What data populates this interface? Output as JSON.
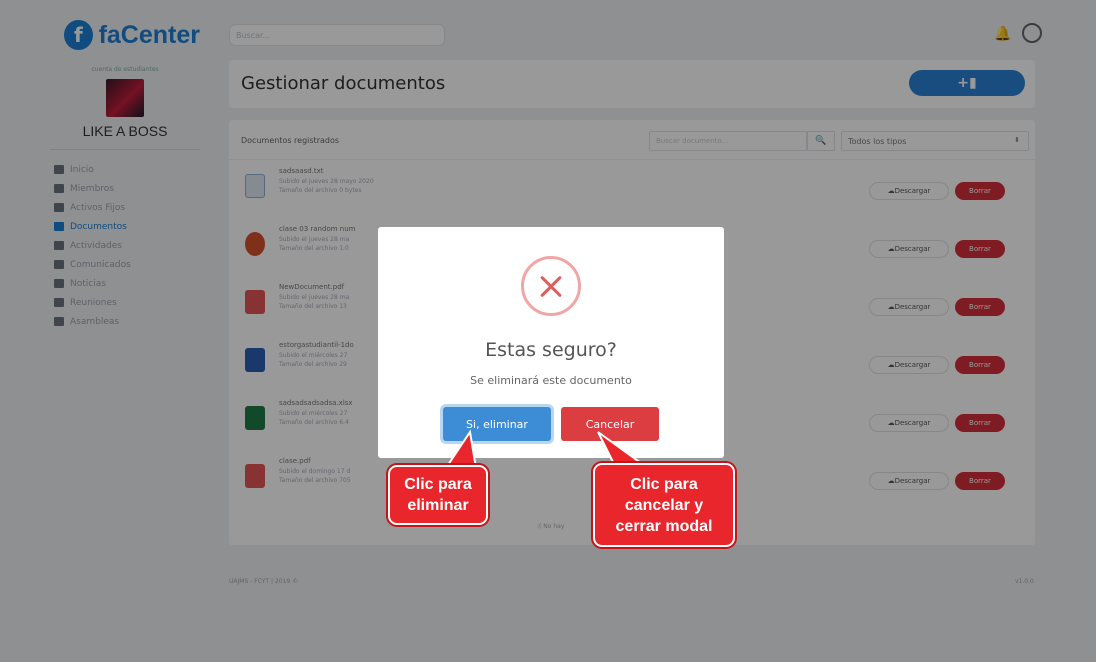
{
  "app": {
    "logo_text": "faCenter",
    "logo_letter": "f",
    "user_caption": "cuenta de estudiantes",
    "user_name": "LIKE A BOSS",
    "nav": [
      {
        "label": "Inicio",
        "active": false
      },
      {
        "label": "Miembros",
        "active": false
      },
      {
        "label": "Activos Fijos",
        "active": false
      },
      {
        "label": "Documentos",
        "active": true
      },
      {
        "label": "Actividades",
        "active": false
      },
      {
        "label": "Comunicados",
        "active": false
      },
      {
        "label": "Noticias",
        "active": false
      },
      {
        "label": "Reuniones",
        "active": false
      },
      {
        "label": "Asambleas",
        "active": false
      }
    ]
  },
  "topbar": {
    "search_placeholder": "Buscar..."
  },
  "page": {
    "title": "Gestionar documentos",
    "add_button_label": "+▮"
  },
  "documents": {
    "header_title": "Documentos registrados",
    "search_placeholder": "Buscar documento...",
    "type_filter": "Todos los tipos",
    "download_label": "Descargar",
    "delete_label": "Borrar",
    "rows": [
      {
        "name": "sadsaasd.txt",
        "meta1": "Subido el  jueves 28 mayo 2020",
        "meta2": "Tamaño del archivo  0 bytes",
        "type": "txt"
      },
      {
        "name": "clase 03 random num",
        "meta1": "Subido el  jueves 28 ma",
        "meta2": "Tamaño del archivo  1.0",
        "type": "ppt"
      },
      {
        "name": "NewDocument.pdf",
        "meta1": "Subido el  jueves 28 ma",
        "meta2": "Tamaño del archivo  13",
        "type": "pdf"
      },
      {
        "name": "estorgastudiantil-1do",
        "meta1": "Subido el  miércoles 27",
        "meta2": "Tamaño del archivo  29",
        "type": "doc"
      },
      {
        "name": "sadsadsadsadsa.xlsx",
        "meta1": "Subido el  miércoles 27",
        "meta2": "Tamaño del archivo  6.4",
        "type": "xls"
      },
      {
        "name": "clase.pdf",
        "meta1": "Subido el  domingo 17 d",
        "meta2": "Tamaño del archivo  705",
        "type": "pdf"
      }
    ],
    "no_more_text": ":( No hay"
  },
  "footer": {
    "left": "UAJMS - FCYT | 2019 ©",
    "right": "v1.0.0"
  },
  "modal": {
    "title": "Estas seguro?",
    "text": "Se eliminará este documento",
    "confirm_label": "Si, eliminar",
    "cancel_label": "Cancelar"
  },
  "callouts": {
    "confirm": "Clic para\neliminar",
    "cancel": "Clic para\ncancelar y\ncerrar modal"
  },
  "colors": {
    "brand": "#1b7fd4",
    "danger": "#d42e3a",
    "callout": "#e8262b",
    "confirm": "#3d8dd6"
  }
}
